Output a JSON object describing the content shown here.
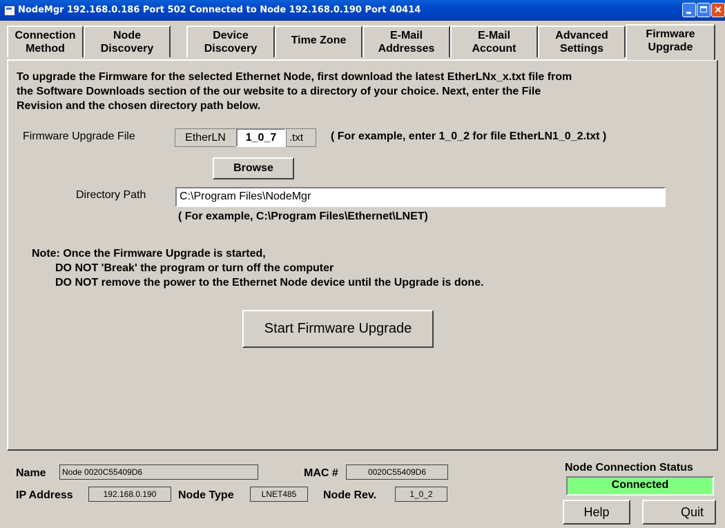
{
  "window": {
    "title": "NodeMgr  192.168.0.186  Port 502   Connected to  Node  192.168.0.190  Port 40414"
  },
  "tabs": [
    {
      "line1": "Connection",
      "line2": "Method"
    },
    {
      "line1": "Node",
      "line2": "Discovery"
    },
    {
      "line1": "Device",
      "line2": "Discovery"
    },
    {
      "line1": "Time Zone",
      "line2": ""
    },
    {
      "line1": "E-Mail",
      "line2": "Addresses"
    },
    {
      "line1": "E-Mail",
      "line2": "Account"
    },
    {
      "line1": "Advanced",
      "line2": "Settings"
    },
    {
      "line1": "Firmware",
      "line2": "Upgrade"
    }
  ],
  "firmware": {
    "intro_line1": "To upgrade the Firmware for the selected Ethernet Node, first download the latest EtherLNx_x.txt file from",
    "intro_line2": "the Software Downloads section of the our website to a directory of your choice.  Next, enter the File",
    "intro_line3": "Revision and the chosen directory path below.",
    "file_label": "Firmware Upgrade File",
    "prefix": "EtherLN",
    "revision": "1_0_7",
    "suffix": ".txt",
    "file_example": "( For example, enter 1_0_2  for file EtherLN1_0_2.txt )",
    "browse_label": "Browse",
    "path_label": "Directory Path",
    "path_value": "C:\\Program Files\\NodeMgr",
    "path_example": "( For example, C:\\Program Files\\Ethernet\\LNET)",
    "note_line1": "Note:  Once the Firmware Upgrade is started,",
    "note_line2": "DO NOT 'Break' the program or turn off the computer",
    "note_line3": "DO NOT remove the power to the Ethernet Node device until the Upgrade is done.",
    "start_label": "Start Firmware Upgrade"
  },
  "footer": {
    "name_label": "Name",
    "name_value": "Node 0020C55409D6",
    "mac_label": "MAC #",
    "mac_value": "0020C55409D6",
    "ip_label": "IP Address",
    "ip_value": "192.168.0.190",
    "type_label": "Node Type",
    "type_value": "LNET485",
    "rev_label": "Node Rev.",
    "rev_value": "1_0_2",
    "status_label": "Node Connection Status",
    "status_value": "Connected",
    "status_color": "#80ff80",
    "help_label": "Help",
    "quit_label": "Quit"
  }
}
